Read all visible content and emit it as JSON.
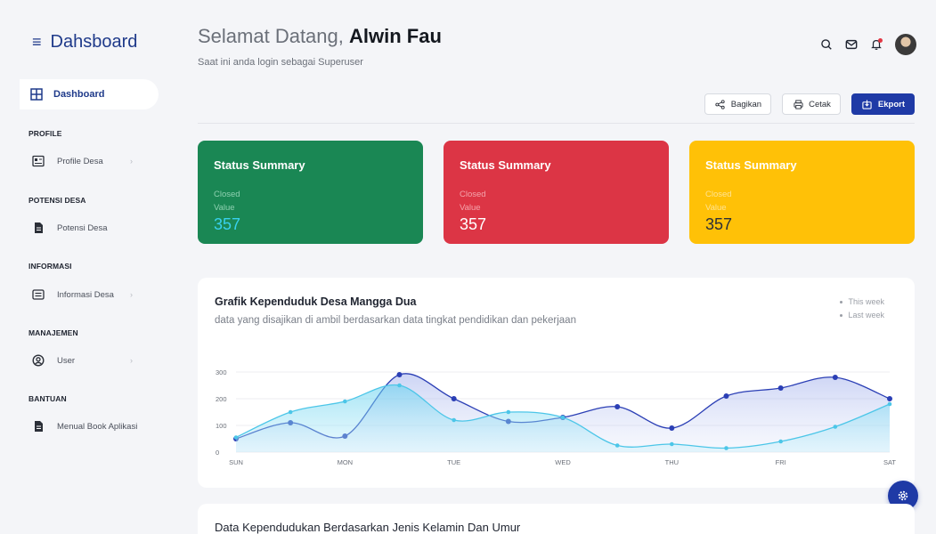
{
  "sidebar": {
    "brand": "Dahsboard",
    "active_item": "Dashboard",
    "sections": [
      {
        "heading": "PROFILE",
        "item": "Profile Desa",
        "chevron": "›"
      },
      {
        "heading": "POTENSI DESA",
        "item": "Potensi Desa"
      },
      {
        "heading": "INFORMASI",
        "item": "Informasi Desa",
        "chevron": "›"
      },
      {
        "heading": "MANAJEMEN",
        "item": "User",
        "chevron": "›"
      },
      {
        "heading": "BANTUAN",
        "item": "Menual Book Aplikasi"
      }
    ]
  },
  "header": {
    "greeting": "Selamat Datang,",
    "user_name": "Alwin Fau",
    "subtitle": "Saat ini anda login sebagai Superuser"
  },
  "actions": {
    "share": "Bagikan",
    "print": "Cetak",
    "export": "Ekport"
  },
  "cards": [
    {
      "title": "Status Summary",
      "line1": "Closed",
      "line2": "Value",
      "value": "357",
      "color": "#1a8754"
    },
    {
      "title": "Status Summary",
      "line1": "Closed",
      "line2": "Value",
      "value": "357",
      "color": "#dc3545"
    },
    {
      "title": "Status Summary",
      "line1": "Closed",
      "line2": "Value",
      "value": "357",
      "color": "#ffc107"
    }
  ],
  "panel": {
    "title": "Grafik Kependuduk Desa Mangga Dua",
    "subtitle": "data yang disajikan di ambil berdasarkan data tingkat pendidikan dan pekerjaan"
  },
  "chart_data": {
    "type": "area",
    "categories": [
      "SUN",
      "MON",
      "TUE",
      "WED",
      "THU",
      "FRI",
      "SAT"
    ],
    "y_ticks": [
      0,
      100,
      200,
      300
    ],
    "ylim": [
      0,
      320
    ],
    "legend": [
      "This week",
      "Last week"
    ],
    "legend_position": "top-right",
    "grid": true,
    "series": [
      {
        "name": "This week",
        "color": "#2b3fb5",
        "x": [
          0,
          0.5,
          1,
          1.5,
          2,
          2.5,
          3,
          3.5,
          4,
          4.5,
          5,
          5.5,
          6
        ],
        "values": [
          50,
          110,
          60,
          290,
          200,
          115,
          130,
          170,
          90,
          210,
          240,
          280,
          200
        ]
      },
      {
        "name": "Last week",
        "color": "#4cc6e8",
        "x": [
          0,
          0.5,
          1,
          1.5,
          2,
          2.5,
          3,
          3.5,
          4,
          4.5,
          5,
          5.5,
          6
        ],
        "values": [
          55,
          150,
          190,
          250,
          120,
          150,
          130,
          25,
          30,
          15,
          40,
          95,
          180
        ]
      }
    ]
  },
  "panel2": {
    "title": "Data Kependudukan Berdasarkan Jenis Kelamin Dan Umur"
  },
  "icons": {
    "menu": "menu-icon",
    "search": "search-icon",
    "mail": "mail-icon",
    "bell": "bell-icon",
    "settings": "gear-icon"
  }
}
